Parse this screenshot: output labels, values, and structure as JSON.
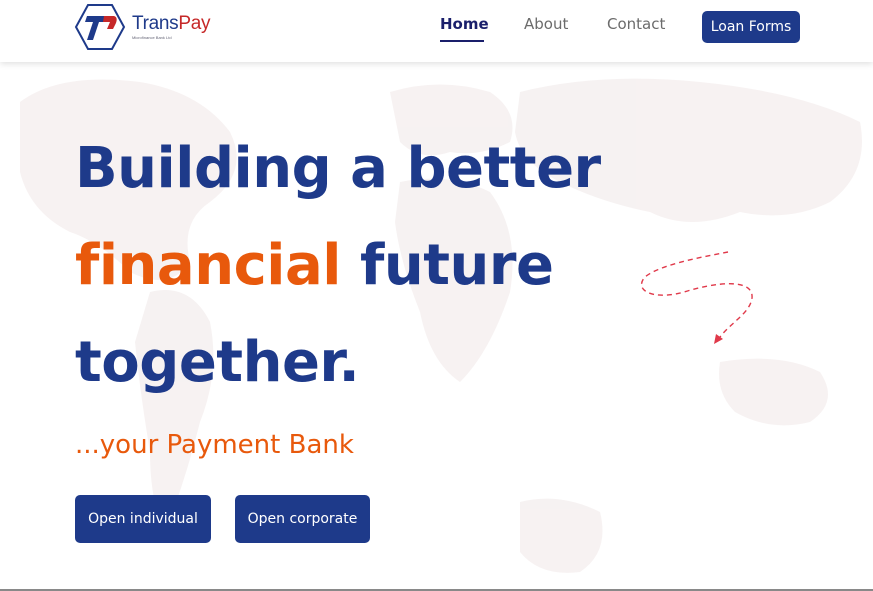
{
  "brand": {
    "name_part1": "Trans",
    "name_part2": "Pay",
    "tagline": "Microfinance Bank Ltd",
    "logo_icon": "transpay-hexagon-logo",
    "colors": {
      "navy": "#1e3a8a",
      "red": "#c62828"
    }
  },
  "nav": {
    "items": [
      {
        "label": "Home",
        "active": true
      },
      {
        "label": "About",
        "active": false
      },
      {
        "label": "Contact",
        "active": false
      }
    ],
    "cta_label": "Loan Forms"
  },
  "hero": {
    "headline_part1": "Building a better",
    "headline_accent": "financial",
    "headline_part2": "future",
    "headline_part3": "together.",
    "subtitle": "...your Payment Bank",
    "buttons": {
      "individual": "Open individual",
      "corporate": "Open corporate"
    },
    "decoration_icon": "dashed-arrow-icon",
    "background_icon": "world-map-icon"
  },
  "theme": {
    "primary": "#1e3a8a",
    "accent": "#e8590c",
    "nav_active": "#1a1f6b",
    "nav_inactive": "#6b6b6b",
    "arrow": "#e0394a"
  }
}
